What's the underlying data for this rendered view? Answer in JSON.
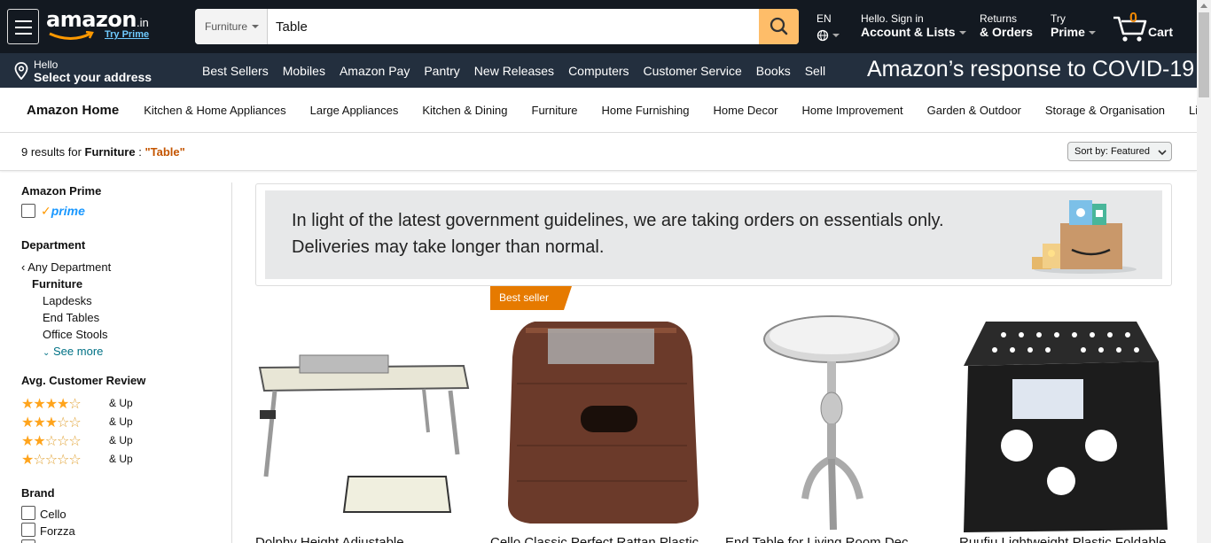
{
  "header": {
    "logo_text": "amazon",
    "logo_suffix": ".in",
    "try_prime_link": "Try Prime",
    "search": {
      "category": "Furniture",
      "query": "Table"
    },
    "language": "EN",
    "account": {
      "line1": "Hello. Sign in",
      "line2": "Account & Lists"
    },
    "orders": {
      "line1": "Returns",
      "line2": "& Orders"
    },
    "prime": {
      "line1": "Try",
      "line2": "Prime"
    },
    "cart": {
      "count": "0",
      "label": "Cart"
    },
    "address": {
      "line1": "Hello",
      "line2": "Select your address"
    },
    "nav_links": [
      "Best Sellers",
      "Mobiles",
      "Amazon Pay",
      "Pantry",
      "New Releases",
      "Computers",
      "Customer Service",
      "Books",
      "Sell"
    ],
    "covid_banner": "Amazon’s response to COVID-19"
  },
  "subnav": {
    "home": "Amazon Home",
    "items": [
      "Kitchen & Home Appliances",
      "Large Appliances",
      "Kitchen & Dining",
      "Furniture",
      "Home Furnishing",
      "Home Decor",
      "Home Improvement",
      "Garden & Outdoor",
      "Storage & Organisation",
      "Lighting"
    ]
  },
  "results": {
    "count_text": "9 results for",
    "category": "Furniture",
    "separator": " : ",
    "query": "\"Table\"",
    "sort_label": "Sort by:",
    "sort_value": "Featured"
  },
  "sidebar": {
    "prime_heading": "Amazon Prime",
    "prime_label": "prime",
    "department_heading": "Department",
    "any_department": "Any Department",
    "current_department": "Furniture",
    "departments": [
      "Lapdesks",
      "End Tables",
      "Office Stools"
    ],
    "see_more": "See more",
    "review_heading": "Avg. Customer Review",
    "reviews": [
      {
        "stars": 4,
        "label": "& Up"
      },
      {
        "stars": 3,
        "label": "& Up"
      },
      {
        "stars": 2,
        "label": "& Up"
      },
      {
        "stars": 1,
        "label": "& Up"
      }
    ],
    "brand_heading": "Brand",
    "brands": [
      "Cello",
      "Forzza"
    ]
  },
  "banner": {
    "line1": "In light of the latest government guidelines, we are taking orders on essentials only.",
    "line2": "Deliveries may take longer than normal."
  },
  "products": [
    {
      "title": "Dolphy Height Adjustable ..."
    },
    {
      "title": "Cello Classic Perfect Rattan Plastic ...",
      "badge": "Best seller"
    },
    {
      "title": "End Table for Living Room Dec..."
    },
    {
      "title": "Ruufiu Lightweight Plastic Foldable ..."
    }
  ],
  "colors": {
    "nav_dark": "#131921",
    "nav_mid": "#232f3e",
    "search_button": "#febd69",
    "accent_orange": "#c45500",
    "badge": "#e67a00",
    "prime_blue": "#1a98ff"
  }
}
